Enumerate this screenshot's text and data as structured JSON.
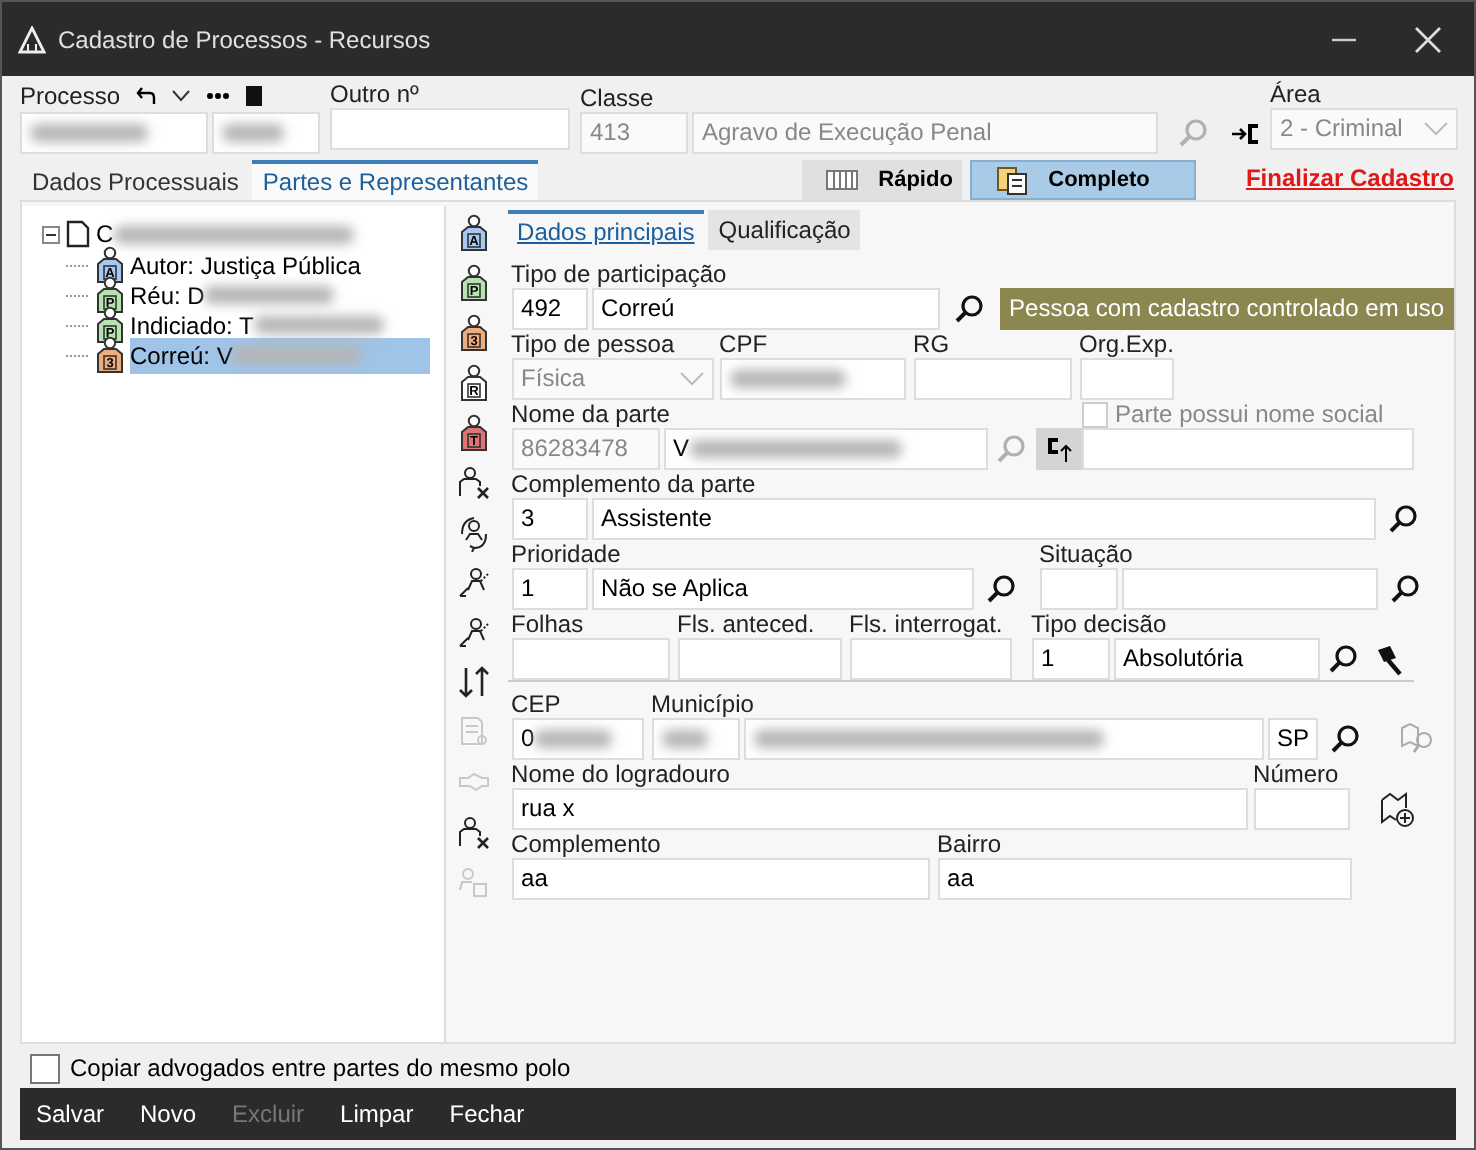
{
  "window": {
    "title": "Cadastro de Processos - Recursos"
  },
  "header": {
    "processo": {
      "label": "Processo",
      "fields": [
        {
          "redacted": true
        },
        {
          "redacted": true
        }
      ]
    },
    "outro": {
      "label": "Outro nº"
    },
    "classe": {
      "label": "Classe",
      "code": "413",
      "name": "Agravo de Execução Penal"
    },
    "area": {
      "label": "Área",
      "value": "2 - Criminal"
    }
  },
  "tabs": [
    {
      "label": "Dados Processuais",
      "selected": false
    },
    {
      "label": "Partes e Representantes",
      "selected": true
    }
  ],
  "view_buttons": [
    {
      "label": "Rápido",
      "selected": false
    },
    {
      "label": "Completo",
      "selected": true
    }
  ],
  "finalize_link": "Finalizar Cadastro",
  "tree": {
    "label": "C",
    "redacted": true,
    "expanded": true,
    "children": [
      {
        "label": "Autor: Justiça Pública",
        "badge": "A",
        "color": "#a9c8ef",
        "selected": false
      },
      {
        "label": "Réu: D",
        "badge": "P",
        "color": "#b6e3b0",
        "redacted": true,
        "selected": false
      },
      {
        "label": "Indiciado: T",
        "badge": "P",
        "color": "#b6e3b0",
        "redacted": true,
        "selected": false
      },
      {
        "label": "Correú: V",
        "badge": "3",
        "color": "#efad7c",
        "redacted": true,
        "selected": true
      }
    ]
  },
  "side_tools": [
    {
      "kind": "person",
      "badge": "A",
      "color": "#a9c8ef",
      "disabled": false
    },
    {
      "kind": "person",
      "badge": "P",
      "color": "#b6e3b0",
      "disabled": false
    },
    {
      "kind": "person",
      "badge": "3",
      "color": "#efad7c",
      "disabled": false
    },
    {
      "kind": "person",
      "badge": "R",
      "color": "#ffffff",
      "disabled": false
    },
    {
      "kind": "person",
      "badge": "T",
      "color": "#e07474",
      "disabled": false
    },
    {
      "kind": "person_remove",
      "disabled": false
    },
    {
      "kind": "person_cycle",
      "disabled": false
    },
    {
      "kind": "person_swap",
      "disabled": false
    },
    {
      "kind": "person_swap",
      "disabled": false
    },
    {
      "kind": "sort",
      "disabled": false
    },
    {
      "kind": "document",
      "disabled": true
    },
    {
      "kind": "handshake",
      "disabled": true
    },
    {
      "kind": "person_remove",
      "disabled": false
    },
    {
      "kind": "person_copy",
      "disabled": true
    }
  ],
  "subtabs": [
    {
      "label": "Dados principais",
      "selected": true
    },
    {
      "label": "Qualificação",
      "selected": false
    }
  ],
  "form_rows": [
    {
      "groups": [
        {
          "label": "Tipo de participação",
          "items": [
            {
              "kind": "input",
              "value": "492"
            },
            {
              "kind": "input",
              "value": "Correú"
            },
            {
              "kind": "search",
              "disabled": false
            },
            {
              "kind": "status",
              "text": "Pessoa com cadastro controlado em uso"
            }
          ]
        }
      ]
    },
    {
      "groups": [
        {
          "label": "Tipo de pessoa",
          "items": [
            {
              "kind": "select",
              "value": "Física",
              "disabled": true
            }
          ]
        },
        {
          "label": "CPF",
          "items": [
            {
              "kind": "input",
              "redacted": true
            }
          ]
        },
        {
          "label": "RG",
          "items": [
            {
              "kind": "input"
            }
          ]
        },
        {
          "label": "Org.Exp.",
          "items": [
            {
              "kind": "input"
            }
          ]
        }
      ]
    },
    {
      "groups": [
        {
          "label": "Nome da parte",
          "items": [
            {
              "kind": "input",
              "value": "86283478",
              "disabled": true
            },
            {
              "kind": "input",
              "value": "V",
              "redacted": true
            },
            {
              "kind": "search",
              "disabled": true
            },
            {
              "kind": "link_button"
            }
          ]
        },
        {
          "check": {
            "label": "Parte possui nome social",
            "checked": false,
            "disabled": true
          },
          "items": [
            {
              "kind": "input"
            }
          ]
        }
      ]
    },
    {
      "groups": [
        {
          "label": "Complemento da parte",
          "items": [
            {
              "kind": "input",
              "value": "3"
            },
            {
              "kind": "input",
              "value": "Assistente"
            },
            {
              "kind": "search",
              "disabled": false
            }
          ]
        }
      ]
    },
    {
      "groups": [
        {
          "label": "Prioridade",
          "items": [
            {
              "kind": "input",
              "value": "1"
            },
            {
              "kind": "input",
              "value": "Não se Aplica"
            },
            {
              "kind": "search",
              "disabled": false
            }
          ]
        },
        {
          "label": "Situação",
          "items": [
            {
              "kind": "input"
            },
            {
              "kind": "input"
            },
            {
              "kind": "search",
              "disabled": false
            }
          ]
        }
      ]
    },
    {
      "groups": [
        {
          "label": "Folhas",
          "items": [
            {
              "kind": "input"
            }
          ]
        },
        {
          "label": "Fls. anteced.",
          "items": [
            {
              "kind": "input"
            }
          ]
        },
        {
          "label": "Fls. interrogat.",
          "items": [
            {
              "kind": "input"
            }
          ]
        },
        {
          "label": "Tipo decisão",
          "items": [
            {
              "kind": "input",
              "value": "1"
            },
            {
              "kind": "input",
              "value": "Absolutória"
            },
            {
              "kind": "search",
              "disabled": false
            },
            {
              "kind": "gavel"
            }
          ]
        }
      ]
    },
    {
      "groups": [
        {
          "label": "CEP",
          "items": [
            {
              "kind": "input",
              "value": "0",
              "redacted": true
            }
          ]
        },
        {
          "label": "Município",
          "items": [
            {
              "kind": "input",
              "redacted": true
            },
            {
              "kind": "input",
              "redacted": true
            },
            {
              "kind": "input",
              "value": "SP"
            },
            {
              "kind": "search",
              "disabled": false
            },
            {
              "kind": "map_search"
            }
          ]
        }
      ]
    },
    {
      "groups": [
        {
          "label": "Nome do logradouro",
          "items": [
            {
              "kind": "input",
              "value": "rua x"
            }
          ]
        },
        {
          "label": "Número",
          "items": [
            {
              "kind": "input"
            },
            {
              "kind": "map_add"
            }
          ]
        }
      ]
    },
    {
      "groups": [
        {
          "label": "Complemento",
          "items": [
            {
              "kind": "input",
              "value": "aa"
            }
          ]
        },
        {
          "label": "Bairro",
          "items": [
            {
              "kind": "input",
              "value": "aa"
            }
          ]
        }
      ]
    }
  ],
  "copy_lawyers": {
    "label": "Copiar advogados entre partes do mesmo polo",
    "checked": false
  },
  "footer_buttons": [
    {
      "label": "Salvar",
      "disabled": false
    },
    {
      "label": "Novo",
      "disabled": false
    },
    {
      "label": "Excluir",
      "disabled": true
    },
    {
      "label": "Limpar",
      "disabled": false
    },
    {
      "label": "Fechar",
      "disabled": false
    }
  ]
}
